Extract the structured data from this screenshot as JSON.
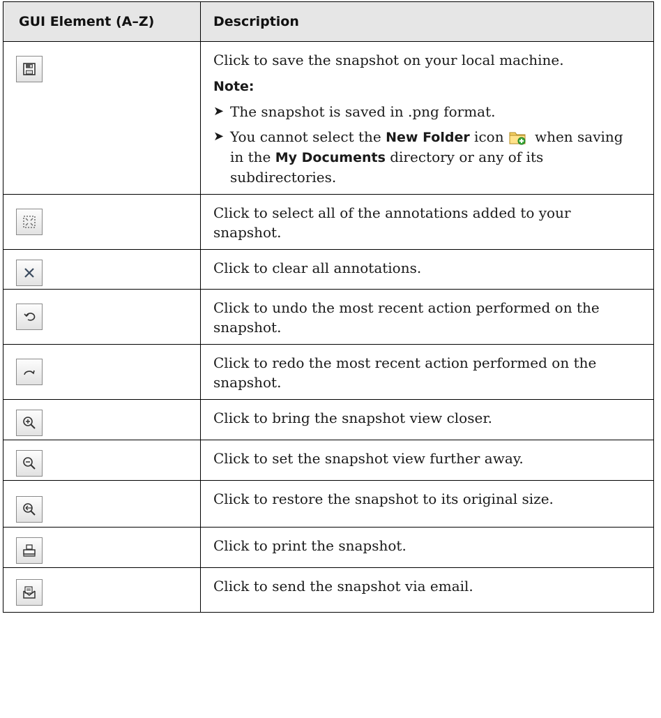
{
  "header": {
    "col1": "GUI Element (A–Z)",
    "col2": "Description"
  },
  "rows": {
    "save": {
      "icon": "floppy-disk-icon",
      "text": "Click to save the snapshot on your local machine.",
      "note_label": "Note:",
      "bullet1": "The snapshot is saved in .png format.",
      "b2_a": "You cannot select the ",
      "b2_bold1": "New Folder",
      "b2_b": " icon",
      "b2_icon": "new-folder-icon",
      "b2_c": " when saving in the ",
      "b2_bold2": "My Documents",
      "b2_d": " directory or any of its subdirectories."
    },
    "select_all": {
      "icon": "select-all-icon",
      "text": "Click to select all of the annotations added to your snapshot."
    },
    "clear": {
      "icon": "close-x-icon",
      "text": "Click to clear all annotations."
    },
    "undo": {
      "icon": "undo-icon",
      "text": "Click to undo the most recent action performed on the snapshot."
    },
    "redo": {
      "icon": "redo-icon",
      "text": "Click to redo the most recent action performed on the snapshot."
    },
    "zoom_in": {
      "icon": "zoom-in-icon",
      "text": "Click to bring the snapshot view closer."
    },
    "zoom_out": {
      "icon": "zoom-out-icon",
      "text": "Click to set the snapshot view further away."
    },
    "restore": {
      "icon": "restore-size-icon",
      "text": "Click to restore the snapshot to its original size."
    },
    "print": {
      "icon": "print-icon",
      "text": "Click to print the snapshot."
    },
    "email": {
      "icon": "email-icon",
      "text": "Click to send the snapshot via email."
    }
  }
}
